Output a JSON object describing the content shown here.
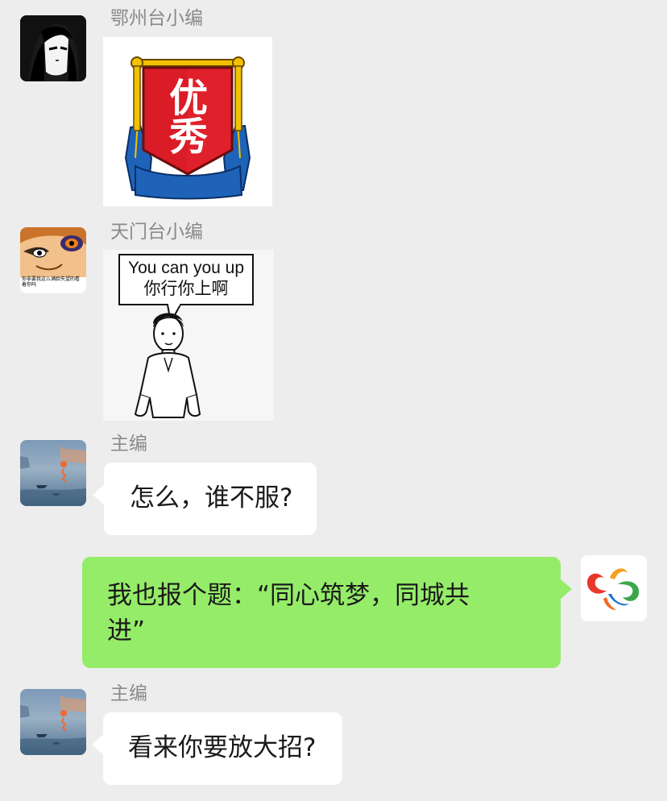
{
  "messages": [
    {
      "sender": "鄂州台小编",
      "avatar_icon": "anime-girl-avatar-icon",
      "type": "sticker",
      "sticker_icon": "excellent-banner-sticker-icon",
      "sticker_text": [
        "优",
        "秀"
      ]
    },
    {
      "sender": "天门台小编",
      "avatar_icon": "cartoon-boy-avatar-icon",
      "avatar_caption": [
        "你非要我这么满脸失望的看",
        "着你吗"
      ],
      "type": "sticker",
      "sticker_icon": "you-can-you-up-meme-icon",
      "sticker_text": [
        "You can you up",
        "你行你上啊"
      ]
    },
    {
      "sender": "主编",
      "avatar_icon": "sunrise-painting-avatar-icon",
      "type": "text",
      "text": "怎么，谁不服?"
    },
    {
      "sender": "",
      "avatar_icon": "swirl-logo-avatar-icon",
      "type": "text",
      "outgoing": true,
      "text_lines": [
        "我也报个题：“同心筑梦，同城共",
        "进”"
      ]
    },
    {
      "sender": "主编",
      "avatar_icon": "sunrise-painting-avatar-icon",
      "type": "text",
      "text": "看来你要放大招?"
    }
  ],
  "colors": {
    "background": "#ededed",
    "incoming_bubble": "#ffffff",
    "outgoing_bubble": "#95ec69",
    "sender_name": "#8a8a8a",
    "banner_red": "#e0202a",
    "banner_blue": "#1e63b8",
    "banner_gold": "#f2c200"
  }
}
